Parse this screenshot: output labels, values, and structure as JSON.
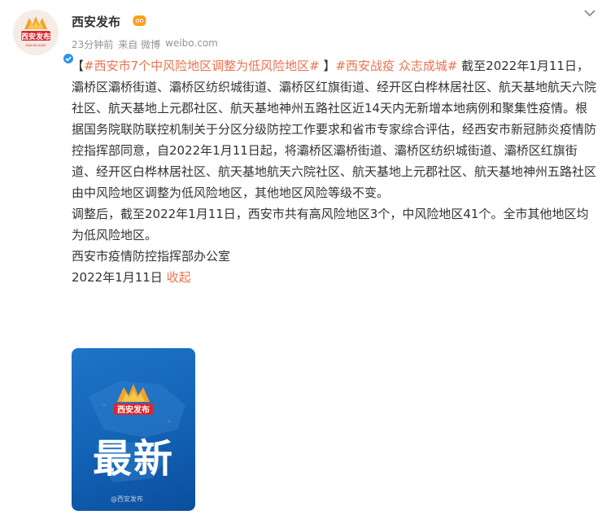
{
  "post": {
    "account_name": "西安发布",
    "time_ago": "23分钟前",
    "source_prefix": "来自",
    "source_app": "微博",
    "source_domain": "weibo.com",
    "avatar_logo_text": "西安发布",
    "avatar_sub_text": "XIAN RELEASE"
  },
  "content": {
    "line1_bracket_open": "【",
    "line1_topic": "#西安市7个中风险地区调整为低风险地区#",
    "line1_bracket_close": " 】",
    "line1_tag2": "#西安战疫 众志成城#",
    "body1": " 截至2022年1月11日，灞桥区灞桥街道、灞桥区纺织城街道、灞桥区红旗街道、经开区白桦林居社区、航天基地航天六院社区、航天基地上元郡社区、航天基地神州五路社区近14天内无新增本地病例和聚集性疫情。根据国务院联防联控机制关于分区分级防控工作要求和省市专家综合评估，经西安市新冠肺炎疫情防控指挥部同意，自2022年1月11日起，将灞桥区灞桥街道、灞桥区纺织城街道、灞桥区红旗街道、经开区白桦林居社区、航天基地航天六院社区、航天基地上元郡社区、航天基地神州五路社区由中风险地区调整为低风险地区，其他地区风险等级不变。",
    "body2": "调整后，截至2022年1月11日，西安市共有高风险地区3个，中风险地区41个。全市其他地区均为低风险地区。",
    "body3": "西安市疫情防控指挥部办公室",
    "date": "2022年1月11日",
    "collapse_label": "收起"
  },
  "image_card": {
    "big_text": "最新",
    "logo_text": "西安发布",
    "watermark": "@西安发布"
  },
  "colors": {
    "link": "#eb7350",
    "text": "#333333",
    "meta": "#939393",
    "card_blue": "#1466b9",
    "brand_red": "#d8282f"
  },
  "icons": [
    "more-icon",
    "verified-icon",
    "vip-icon",
    "xian-fabu-logo-icon"
  ]
}
